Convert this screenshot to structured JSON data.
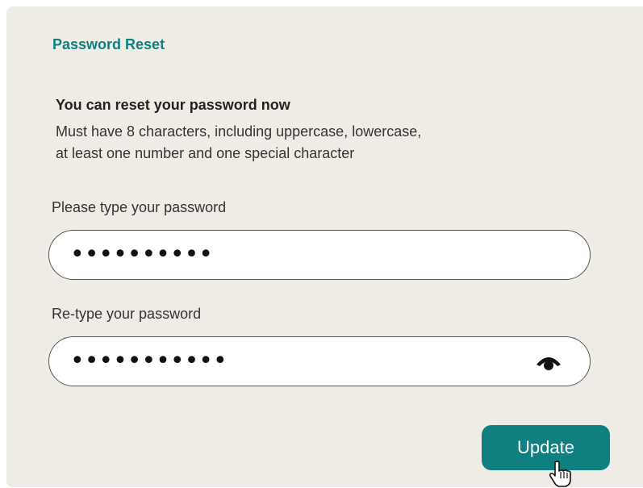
{
  "form": {
    "title": "Password Reset",
    "heading": "You can reset your password now",
    "description_lines": [
      "Must have 8 characters, including uppercase, lowercase,",
      "at least one number and one special character"
    ],
    "password": {
      "label": "Please type your password",
      "masked_value": "••••••••••"
    },
    "confirm_password": {
      "label": "Re-type your password",
      "masked_value": "•••••••••••",
      "toggle_icon": "eye-icon"
    },
    "submit_label": "Update"
  },
  "colors": {
    "accent": "#0f7f80",
    "card_background": "#eeece5",
    "input_background": "#ffffff"
  }
}
